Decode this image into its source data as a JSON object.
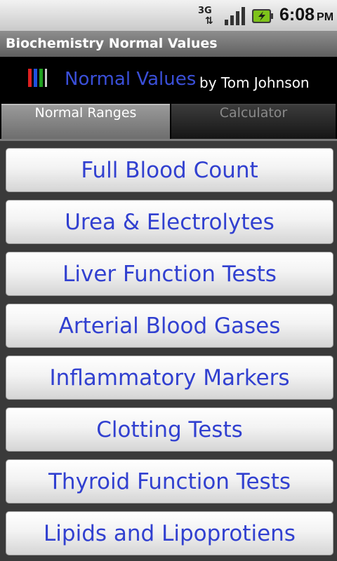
{
  "status_bar": {
    "network": "3G",
    "network_arrows": "⇅",
    "time": "6:08",
    "ampm": "PM",
    "icons": [
      "3g-data-icon",
      "signal-strength-icon",
      "battery-charging-icon"
    ]
  },
  "titlebar": {
    "title": "Biochemistry Normal Values"
  },
  "header": {
    "app_name": "Normal Values",
    "byline": "by Tom Johnson",
    "logo_colors": [
      "#e02020",
      "#2050e0",
      "#20a020"
    ]
  },
  "tabs": [
    {
      "label": "Normal Ranges",
      "selected": true
    },
    {
      "label": "Calculator",
      "selected": false
    }
  ],
  "menu": {
    "items": [
      "Full Blood Count",
      "Urea & Electrolytes",
      "Liver Function Tests",
      "Arterial Blood Gases",
      "Inflammatory Markers",
      "Clotting Tests",
      "Thyroid Function Tests",
      "Lipids and Lipoprotiens"
    ]
  },
  "colors": {
    "accent_blue": "#3140d0",
    "battery_green": "#7ec31a"
  }
}
